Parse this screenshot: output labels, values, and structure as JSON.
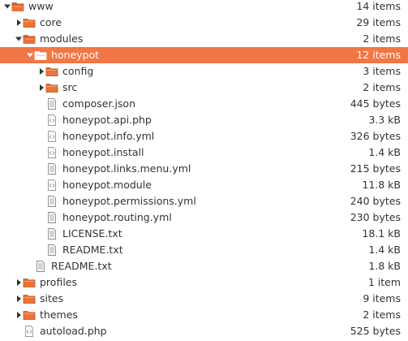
{
  "colors": {
    "selection": "#f07746",
    "folder": "#e9733a",
    "text": "#2e3436"
  },
  "rows": [
    {
      "name": "www",
      "size": "14 items",
      "type": "folder",
      "expander": "open"
    },
    {
      "name": "core",
      "size": "29 items",
      "type": "folder",
      "expander": "closed"
    },
    {
      "name": "modules",
      "size": "2 items",
      "type": "folder",
      "expander": "open"
    },
    {
      "name": "honeypot",
      "size": "12 items",
      "type": "folder",
      "expander": "open",
      "selected": true
    },
    {
      "name": "config",
      "size": "3 items",
      "type": "folder",
      "expander": "closed"
    },
    {
      "name": "src",
      "size": "2 items",
      "type": "folder",
      "expander": "closed"
    },
    {
      "name": "composer.json",
      "size": "445 bytes",
      "type": "text"
    },
    {
      "name": "honeypot.api.php",
      "size": "3.3 kB",
      "type": "code"
    },
    {
      "name": "honeypot.info.yml",
      "size": "326 bytes",
      "type": "code"
    },
    {
      "name": "honeypot.install",
      "size": "1.4 kB",
      "type": "code"
    },
    {
      "name": "honeypot.links.menu.yml",
      "size": "215 bytes",
      "type": "text"
    },
    {
      "name": "honeypot.module",
      "size": "11.8 kB",
      "type": "code"
    },
    {
      "name": "honeypot.permissions.yml",
      "size": "240 bytes",
      "type": "text"
    },
    {
      "name": "honeypot.routing.yml",
      "size": "230 bytes",
      "type": "text"
    },
    {
      "name": "LICENSE.txt",
      "size": "18.1 kB",
      "type": "text"
    },
    {
      "name": "README.txt",
      "size": "1.4 kB",
      "type": "text"
    },
    {
      "name": "README.txt",
      "size": "1.8 kB",
      "type": "text"
    },
    {
      "name": "profiles",
      "size": "1 item",
      "type": "folder",
      "expander": "closed"
    },
    {
      "name": "sites",
      "size": "9 items",
      "type": "folder",
      "expander": "closed"
    },
    {
      "name": "themes",
      "size": "2 items",
      "type": "folder",
      "expander": "closed"
    },
    {
      "name": "autoload.php",
      "size": "525 bytes",
      "type": "code"
    }
  ]
}
